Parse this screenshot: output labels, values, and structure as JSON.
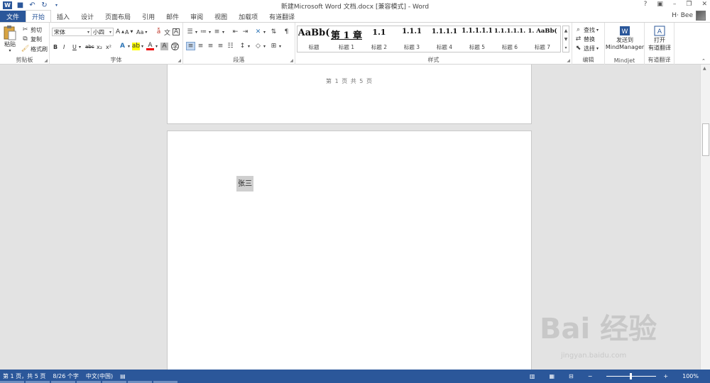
{
  "window": {
    "title": "新建Microsoft Word 文档.docx [兼容模式] - Word",
    "controls": [
      "?",
      "▣",
      "–",
      "❐",
      "✕"
    ],
    "user": "H·  Bee"
  },
  "tabs": {
    "file": "文件",
    "items": [
      "开始",
      "插入",
      "设计",
      "页面布局",
      "引用",
      "邮件",
      "审阅",
      "视图",
      "加载项",
      "有道翻译"
    ],
    "active": "开始"
  },
  "ribbon": {
    "clipboard": {
      "label": "剪贴板",
      "paste": "粘贴",
      "cut": "剪切",
      "copy": "复制",
      "format_painter": "格式刷"
    },
    "font": {
      "label": "字体",
      "font_name": "宋体",
      "font_size": "小四",
      "grow": "A",
      "shrink": "A",
      "case": "Aa",
      "bold": "B",
      "italic": "I",
      "underline": "U",
      "strike": "abc",
      "sub": "x₂",
      "sup": "x²"
    },
    "paragraph": {
      "label": "段落"
    },
    "styles": {
      "label": "样式",
      "items": [
        {
          "sample": "AaBb(",
          "name": "标题"
        },
        {
          "sample": "第 1 章",
          "name": "标题 1"
        },
        {
          "sample": "1.1 ",
          "name": "标题 2"
        },
        {
          "sample": "1.1.1",
          "name": "标题 3"
        },
        {
          "sample": "1.1.1.1",
          "name": "标题 4"
        },
        {
          "sample": "1.1.1.1.1",
          "name": "标题 5"
        },
        {
          "sample": "1.1.1.1.1.",
          "name": "标题 6"
        },
        {
          "sample": "1. AaBb(",
          "name": "标题 7"
        }
      ]
    },
    "editing": {
      "label": "编辑",
      "find": "查找",
      "replace": "替换",
      "select": "选择"
    },
    "mindjet": {
      "label": "Mindjet",
      "send_line1": "发送到",
      "send_line2": "MindManager"
    },
    "youdao": {
      "label": "有道翻译",
      "open_line1": "打开",
      "open_line2": "有道翻译"
    }
  },
  "document": {
    "footer": "第 1 页 共 5 页",
    "content": "张三"
  },
  "status": {
    "page": "第 1 页，共 5 页",
    "words": "8/26 个字",
    "language": "中文(中国)",
    "zoom": "100%",
    "zoom_minus": "−",
    "zoom_plus": "+"
  },
  "watermark": {
    "main": "Bai 经验",
    "sub": "jingyan.baidu.com"
  }
}
